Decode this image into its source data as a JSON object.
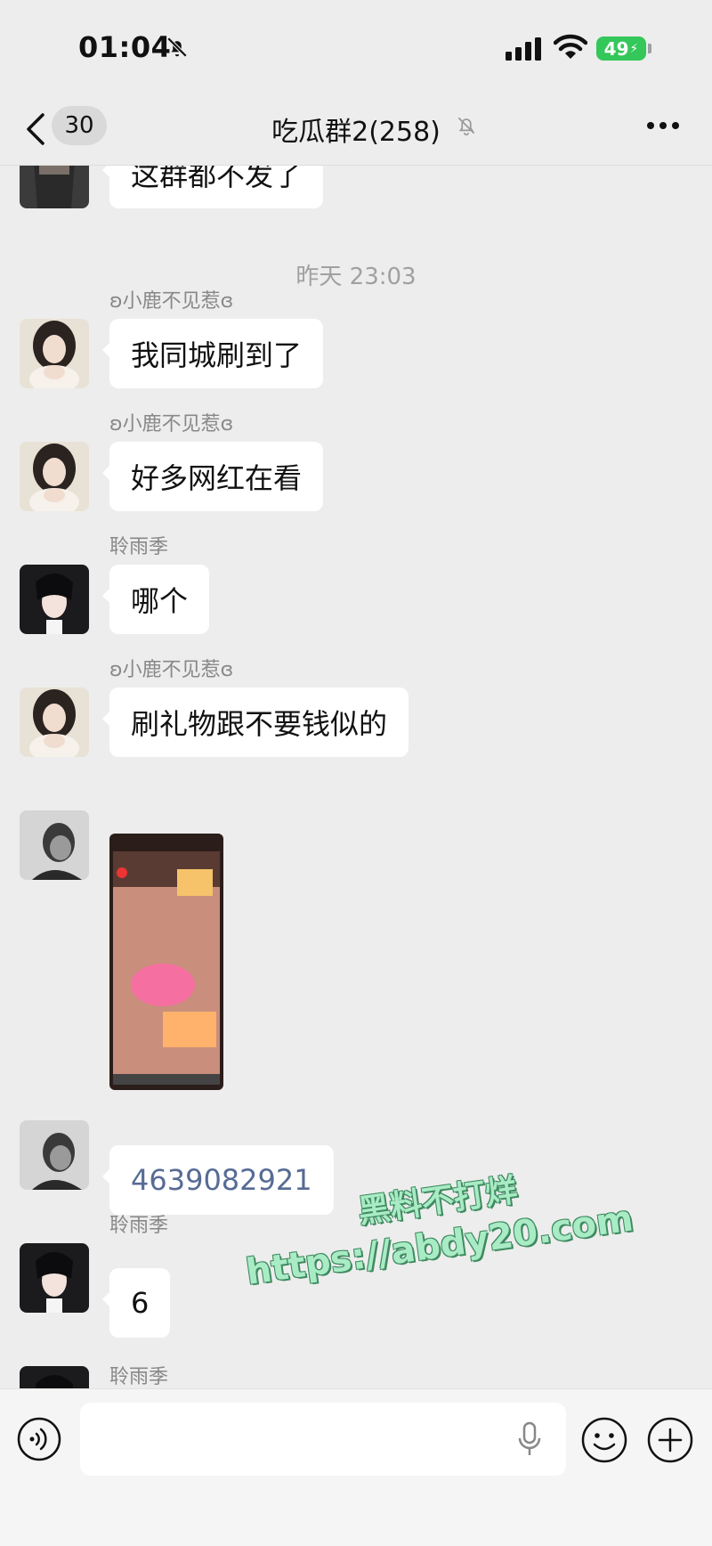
{
  "status_bar": {
    "time": "01:04",
    "battery": "49"
  },
  "header": {
    "back_count": "30",
    "title": "吃瓜群2(258)"
  },
  "messages": [
    {
      "text": "这群都不发了"
    },
    {
      "sender": "ʚ小鹿不见惹ɞ",
      "text": "我同城刷到了"
    },
    {
      "sender": "ʚ小鹿不见惹ɞ",
      "text": "好多网红在看"
    },
    {
      "sender": "聆雨季",
      "text": "哪个"
    },
    {
      "sender": "ʚ小鹿不见惹ɞ",
      "text": "刷礼物跟不要钱似的"
    },
    {
      "sender": "",
      "text": "[screenshot image]"
    },
    {
      "sender": "",
      "text": "4639082921"
    },
    {
      "sender": "聆雨季",
      "text": "6"
    },
    {
      "sender": "聆雨季",
      "text": ""
    }
  ],
  "timestamp": "昨天 23:03",
  "input": {
    "value": "",
    "placeholder": ""
  },
  "watermark": {
    "line1": "黑料不打烊",
    "line2": "https://abdy20.com"
  },
  "colors": {
    "background": "#ededed",
    "bubble": "#ffffff",
    "link": "#576b95",
    "battery": "#34c759"
  },
  "icons": [
    "bell-off-icon",
    "signal-icon",
    "wifi-icon",
    "battery-icon",
    "back-icon",
    "mute-icon",
    "more-icon",
    "voice-icon",
    "mic-icon",
    "emoji-icon",
    "plus-icon"
  ]
}
